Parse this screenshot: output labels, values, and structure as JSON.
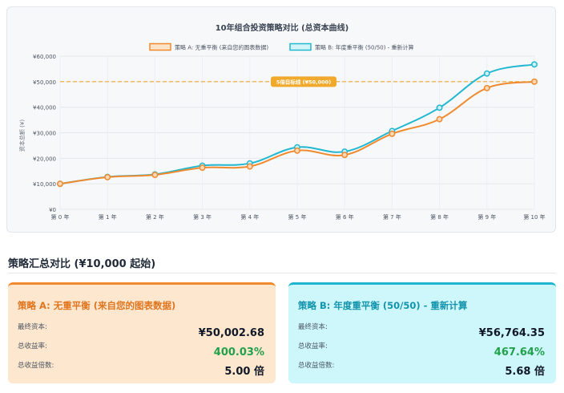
{
  "chart_data": {
    "type": "line",
    "title": "10年组合投资策略对比 (总资本曲线)",
    "ylabel": "资本总额 (¥)",
    "xlabel": "",
    "categories": [
      "第 0 年",
      "第 1 年",
      "第 2 年",
      "第 3 年",
      "第 4 年",
      "第 5 年",
      "第 6 年",
      "第 7 年",
      "第 8 年",
      "第 9 年",
      "第 10 年"
    ],
    "y_ticks": [
      "¥0",
      "¥10,000",
      "¥20,000",
      "¥30,000",
      "¥40,000",
      "¥50,000",
      "¥60,000"
    ],
    "ylim": [
      0,
      60000
    ],
    "grid": true,
    "legend": "top",
    "series": [
      {
        "name": "策略 A: 无重平衡 (来自您的图表数据)",
        "color": "#ef8a2e",
        "values": [
          10000,
          12600,
          13500,
          16300,
          16800,
          23000,
          21300,
          29600,
          35300,
          47500,
          50002.68
        ]
      },
      {
        "name": "策略 B: 年度重平衡 (50/50) - 重新计算",
        "color": "#22b7d0",
        "values": [
          10000,
          12700,
          13700,
          17100,
          18000,
          24300,
          22600,
          30700,
          39800,
          53200,
          56764.35
        ]
      }
    ],
    "target": {
      "value": 50000,
      "label": "5倍目标线 (¥50,000)",
      "color": "#f0a92b"
    }
  },
  "summary": {
    "title": "策略汇总对比 (¥10,000 起始)",
    "strategy_a": {
      "title": "策略 A: 无重平衡 (来自您的图表数据)",
      "final_label": "最终资本:",
      "final_value": "¥50,002.68",
      "return_label": "总收益率:",
      "return_value": "400.03%",
      "multiple_label": "总收益倍数:",
      "multiple_value": "5.00 倍"
    },
    "strategy_b": {
      "title": "策略 B: 年度重平衡 (50/50) - 重新计算",
      "final_label": "最终资本:",
      "final_value": "¥56,764.35",
      "return_label": "总收益率:",
      "return_value": "467.64%",
      "multiple_label": "总收益倍数:",
      "multiple_value": "5.68 倍"
    }
  }
}
